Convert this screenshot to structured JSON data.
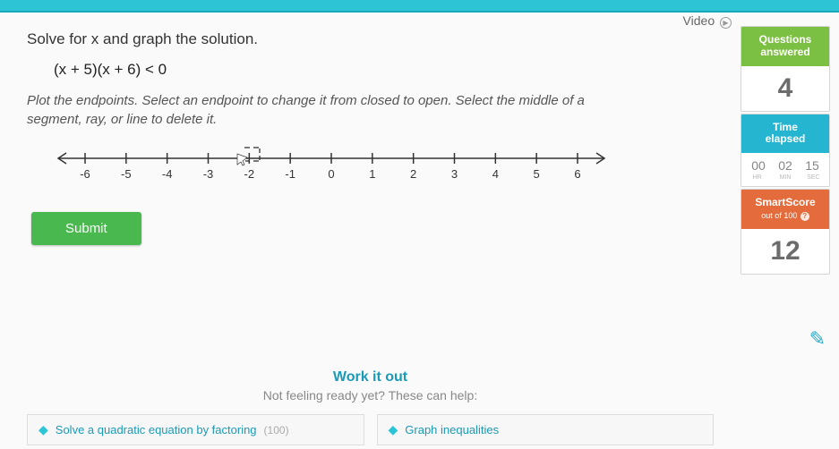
{
  "video_label": "Video",
  "prompt": "Solve for x and graph the solution.",
  "expression": "(x + 5)(x + 6) < 0",
  "instruction": "Plot the endpoints. Select an endpoint to change it from closed to open. Select the middle of a segment, ray, or line to delete it.",
  "ticks": [
    "-6",
    "-5",
    "-4",
    "-3",
    "-2",
    "-1",
    "0",
    "1",
    "2",
    "3",
    "4",
    "5",
    "6"
  ],
  "submit_label": "Submit",
  "sidebar": {
    "questions": {
      "title": "Questions\nanswered",
      "value": "4"
    },
    "time": {
      "title": "Time\nelapsed",
      "hh": "00",
      "mm": "02",
      "ss": "15",
      "lbl_h": "HR",
      "lbl_m": "MIN",
      "lbl_s": "SEC"
    },
    "smart": {
      "title": "SmartScore",
      "sub": "out of 100",
      "value": "12"
    }
  },
  "footer": {
    "work": "Work it out",
    "sub": "Not feeling ready yet? These can help:",
    "help1": "Solve a quadratic equation by factoring",
    "help1_score": "(100)",
    "help2": "Graph inequalities"
  }
}
